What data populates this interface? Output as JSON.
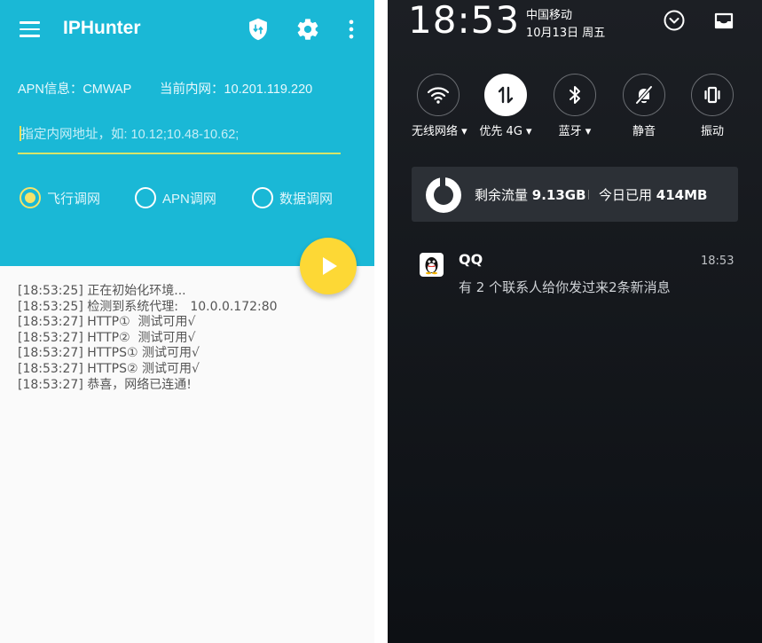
{
  "app": {
    "title": "IPHunter",
    "icons": [
      "menu-icon",
      "shield-icon",
      "gear-icon",
      "more-vert-icon"
    ],
    "colors": {
      "header": "#1ab8d6",
      "accent": "#fdd835"
    },
    "apn_label": "APN信息：CMWAP",
    "intranet_label": "当前内网：10.201.119.220",
    "input_placeholder": "指定内网地址，如: 10.12;10.48-10.62;",
    "radios": [
      {
        "label": "飞行调网",
        "checked": true
      },
      {
        "label": "APN调网",
        "checked": false
      },
      {
        "label": "数据调网",
        "checked": false
      }
    ],
    "log": [
      "[18:53:25] 正在初始化环境...",
      "[18:53:25] 检测到系统代理:   10.0.0.172:80",
      "[18:53:27] HTTP①  测试可用√",
      "[18:53:27] HTTP②  测试可用√",
      "[18:53:27] HTTPS① 测试可用√",
      "[18:53:27] HTTPS② 测试可用√",
      "[18:53:27] 恭喜，网络已连通!"
    ]
  },
  "status": {
    "time": "18:53",
    "carrier": "中国移动",
    "date": "10月13日 周五",
    "tiles": [
      {
        "label": "无线网络",
        "icon": "wifi-icon",
        "dropdown": true,
        "active": false
      },
      {
        "label": "优先 4G",
        "icon": "data-arrows-icon",
        "dropdown": true,
        "active": true
      },
      {
        "label": "蓝牙",
        "icon": "bluetooth-icon",
        "dropdown": true,
        "active": false
      },
      {
        "label": "静音",
        "icon": "bell-off-icon",
        "dropdown": false,
        "active": false
      },
      {
        "label": "振动",
        "icon": "vibrate-icon",
        "dropdown": false,
        "active": false
      }
    ],
    "data_remaining_label": "剩余流量",
    "data_remaining_value": "9.13GB",
    "data_used_label": "今日已用",
    "data_used_value": "414MB",
    "notification": {
      "app": "QQ",
      "time": "18:53",
      "message": "有 2 个联系人给你发过来2条新消息"
    }
  }
}
